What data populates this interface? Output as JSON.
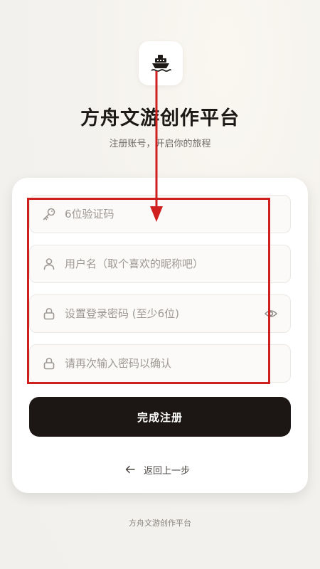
{
  "header": {
    "logo_icon": "ship-icon",
    "title": "方舟文游创作平台",
    "subtitle": "注册账号，开启你的旅程"
  },
  "form": {
    "verification_code": {
      "placeholder": "6位验证码",
      "icon": "key-icon",
      "value": ""
    },
    "username": {
      "placeholder": "用户名（取个喜欢的昵称吧）",
      "icon": "user-icon",
      "value": ""
    },
    "password": {
      "placeholder": "设置登录密码 (至少6位)",
      "icon": "lock-icon",
      "toggle_icon": "eye-icon",
      "value": ""
    },
    "confirm_password": {
      "placeholder": "请再次输入密码以确认",
      "icon": "lock-icon",
      "value": ""
    },
    "submit_label": "完成注册",
    "back_label": "返回上一步",
    "back_icon": "arrow-left-icon"
  },
  "footer": {
    "text": "方舟文游创作平台"
  },
  "colors": {
    "background": "#f3f1ee",
    "card": "#ffffff",
    "primary_button": "#1c1714",
    "annotation": "#d01f1f"
  }
}
